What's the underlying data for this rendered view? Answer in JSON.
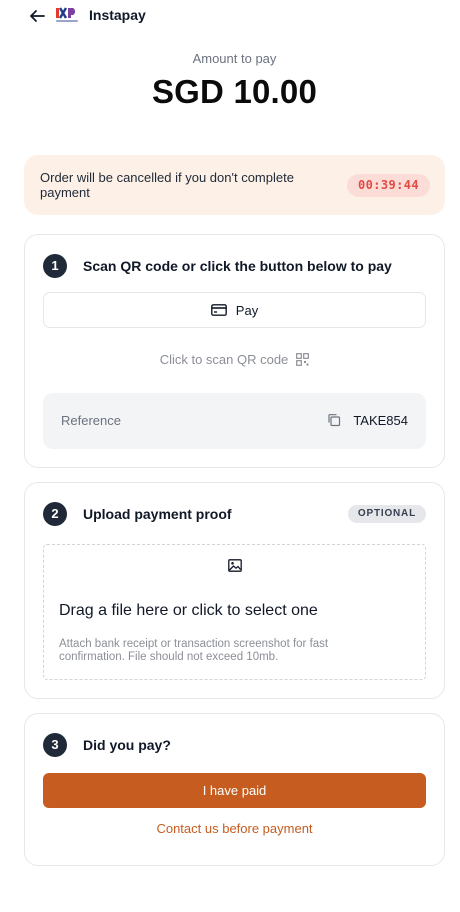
{
  "header": {
    "title": "Instapay",
    "back_icon": "arrow-left-icon",
    "logo": "instapay-logo"
  },
  "amount": {
    "label": "Amount to pay",
    "value": "SGD 10.00"
  },
  "warning": {
    "message": "Order will be cancelled if you don't complete payment",
    "timer": "00:39:44",
    "background": "#fdf1e7",
    "timer_color": "#e14b45"
  },
  "step1": {
    "number": "1",
    "title": "Scan QR code or click the button below to pay",
    "pay_button": "Pay",
    "pay_icon": "credit-card-icon",
    "scan_link": "Click to scan QR code",
    "scan_icon": "qr-code-icon",
    "reference_label": "Reference",
    "reference_value": "TAKE854",
    "copy_icon": "copy-icon"
  },
  "step2": {
    "number": "2",
    "title": "Upload payment proof",
    "badge": "OPTIONAL",
    "upload_icon": "image-icon",
    "dropzone_title": "Drag a file here or click to select one",
    "dropzone_hint": "Attach bank receipt or transaction screenshot for fast confirmation. File should not exceed 10mb."
  },
  "step3": {
    "number": "3",
    "title": "Did you pay?",
    "paid_button": "I have paid",
    "contact_link": "Contact us before payment"
  },
  "colors": {
    "accent": "#c65c1f",
    "step_badge": "#1f2937"
  }
}
